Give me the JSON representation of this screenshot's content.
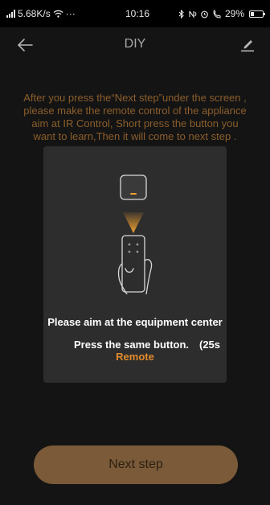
{
  "status_bar": {
    "network": "5.68K/s",
    "dots": "···",
    "time": "10:16",
    "battery": "29%",
    "battery_level": 0.29
  },
  "header": {
    "title": "DIY",
    "back_icon": "arrow-left-icon",
    "edit_icon": "pencil-icon"
  },
  "instruction": "After you press the“Next step”under the screen , please make the remote control of the appliance aim at IR Control, Short press the button you want to learn,Then it  will come to next step .",
  "card": {
    "aim_text": "Please aim at the equipment center",
    "press_text": "Press the same button.",
    "countdown": "(25s",
    "remote_label": "Remote"
  },
  "next_button": {
    "label": "Next step"
  },
  "colors": {
    "background": "#141414",
    "card": "#2d2d2d",
    "accent": "#e28a2c",
    "instruction": "#8c5e2c",
    "button": "#7a5a38"
  }
}
